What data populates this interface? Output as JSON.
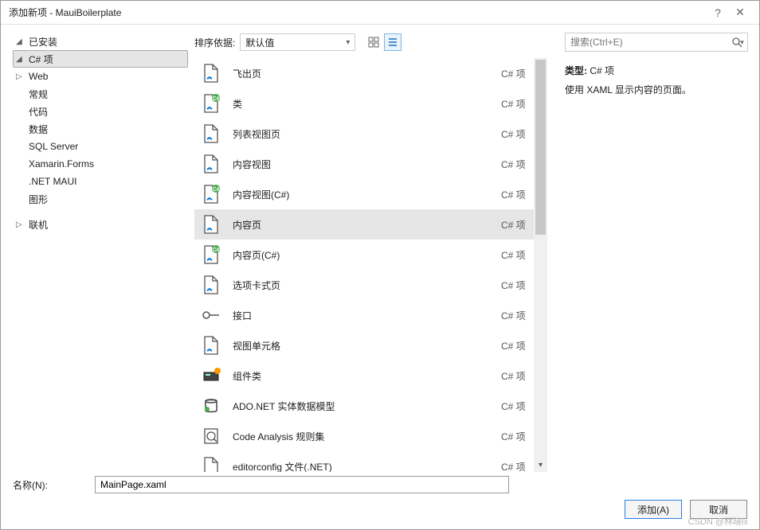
{
  "window": {
    "title": "添加新项 - MauiBoilerplate"
  },
  "sidebar": {
    "installed": "已安装",
    "items": [
      {
        "label": "C# 项",
        "expanded": true,
        "selected": true,
        "children": true,
        "depth": 1
      },
      {
        "label": "Web",
        "expanded": false,
        "children": true,
        "depth": 2
      },
      {
        "label": "常规",
        "children": false,
        "depth": 2
      },
      {
        "label": "代码",
        "children": false,
        "depth": 2
      },
      {
        "label": "数据",
        "children": false,
        "depth": 2
      },
      {
        "label": "SQL Server",
        "children": false,
        "depth": 2
      },
      {
        "label": "Xamarin.Forms",
        "children": false,
        "depth": 2
      },
      {
        "label": ".NET MAUI",
        "children": false,
        "depth": 2
      },
      {
        "label": "图形",
        "children": false,
        "depth": 1
      }
    ],
    "online": "联机"
  },
  "topbar": {
    "sortLabel": "排序依据:",
    "sortValue": "默认值"
  },
  "templates": [
    {
      "name": "飞出页",
      "lang": "C# 项",
      "icon": "xaml"
    },
    {
      "name": "类",
      "lang": "C# 项",
      "icon": "cs"
    },
    {
      "name": "列表视图页",
      "lang": "C# 项",
      "icon": "xaml"
    },
    {
      "name": "内容视图",
      "lang": "C# 项",
      "icon": "xaml"
    },
    {
      "name": "内容视图(C#)",
      "lang": "C# 项",
      "icon": "cs"
    },
    {
      "name": "内容页",
      "lang": "C# 项",
      "icon": "xaml",
      "selected": true
    },
    {
      "name": "内容页(C#)",
      "lang": "C# 项",
      "icon": "cs"
    },
    {
      "name": "选项卡式页",
      "lang": "C# 项",
      "icon": "xaml"
    },
    {
      "name": "接口",
      "lang": "C# 项",
      "icon": "interface"
    },
    {
      "name": "视图单元格",
      "lang": "C# 项",
      "icon": "xaml"
    },
    {
      "name": "组件类",
      "lang": "C# 项",
      "icon": "component"
    },
    {
      "name": "ADO.NET 实体数据模型",
      "lang": "C# 项",
      "icon": "ado"
    },
    {
      "name": "Code Analysis 规则集",
      "lang": "C# 项",
      "icon": "analysis"
    },
    {
      "name": "editorconfig 文件(.NET)",
      "lang": "C# 项",
      "icon": "file"
    }
  ],
  "details": {
    "typeKey": "类型:",
    "typeValue": "C# 项",
    "desc": "使用 XAML 显示内容的页面。"
  },
  "search": {
    "placeholder": "搜索(Ctrl+E)"
  },
  "name": {
    "label": "名称(N):",
    "value": "MainPage.xaml"
  },
  "buttons": {
    "add": "添加(A)",
    "cancel": "取消"
  },
  "watermark": "CSDN @林晓lx"
}
